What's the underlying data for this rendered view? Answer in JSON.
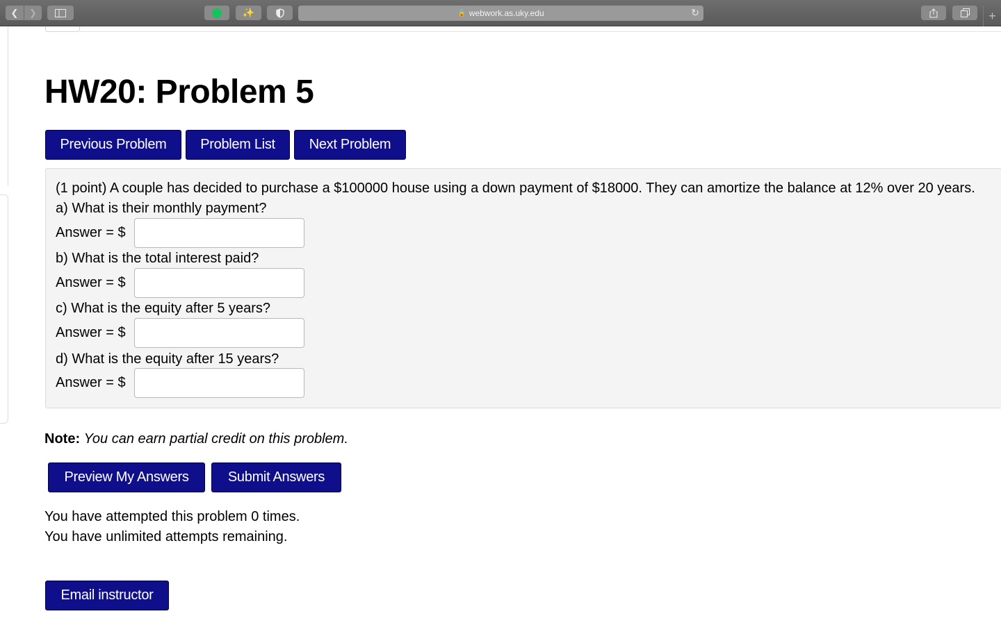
{
  "browser": {
    "url": "webwork.as.uky.edu"
  },
  "page": {
    "title": "HW20: Problem 5"
  },
  "nav": {
    "previous": "Previous Problem",
    "list": "Problem List",
    "next": "Next Problem"
  },
  "problem": {
    "intro": "(1 point) A couple has decided to purchase a $100000 house using a down payment of $18000. They can amortize the balance at 12% over 20 years.",
    "answer_label": "Answer = $",
    "parts": [
      {
        "question": "a) What is their monthly payment?",
        "value": ""
      },
      {
        "question": "b) What is the total interest paid?",
        "value": ""
      },
      {
        "question": "c) What is the equity after 5 years?",
        "value": ""
      },
      {
        "question": "d) What is the equity after 15 years?",
        "value": ""
      }
    ]
  },
  "note": {
    "label": "Note:",
    "text": "You can earn partial credit on this problem."
  },
  "actions": {
    "preview": "Preview My Answers",
    "submit": "Submit Answers",
    "email": "Email instructor"
  },
  "status": {
    "attempted": "You have attempted this problem 0 times.",
    "remaining": "You have unlimited attempts remaining."
  },
  "colors": {
    "button": "#0f0f8c",
    "problem_bg": "#f4f4f4"
  }
}
